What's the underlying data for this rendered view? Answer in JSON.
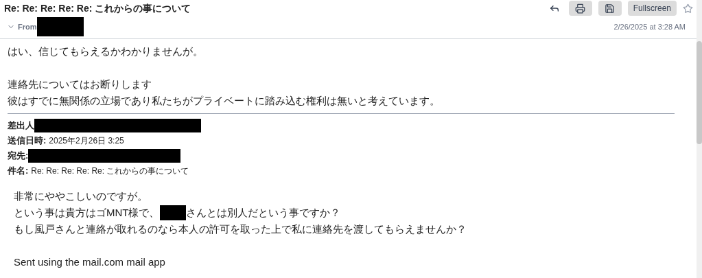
{
  "header": {
    "subject": "Re: Re: Re: Re: Re: これからの事について",
    "from_label": "From",
    "date": "2/26/2025 at 3:28 AM",
    "toolbar": [
      {
        "kind": "reply"
      },
      {
        "kind": "print"
      },
      {
        "kind": "save"
      },
      {
        "kind": "text",
        "label": "Fullscreen"
      },
      {
        "kind": "star"
      }
    ]
  },
  "body": [
    {
      "kind": "text",
      "parts": [
        {
          "kind": "text",
          "text": "はい、信じてもらえるかわかりませんが。"
        }
      ]
    },
    {
      "kind": "blank"
    },
    {
      "kind": "text",
      "parts": [
        {
          "kind": "text",
          "text": "連絡先についてはお断りします"
        }
      ]
    },
    {
      "kind": "text",
      "parts": [
        {
          "kind": "text",
          "text": "彼はすでに無関係の立場であり私たちがプライベートに踏み込む権利は無いと考えています。"
        }
      ]
    }
  ],
  "quoted_header": [
    {
      "label": "差出人",
      "kind": "redacted"
    },
    {
      "label": "送信日時:",
      "kind": "text",
      "value": "2025年2月26日 3:25"
    },
    {
      "label": "宛先:",
      "kind": "redacted"
    },
    {
      "label": "件名:",
      "kind": "text",
      "value": "Re: Re: Re: Re: Re: これからの事について"
    }
  ],
  "quoted_body": [
    {
      "kind": "text",
      "parts": [
        {
          "kind": "text",
          "text": "非常にややこしいのですが。"
        }
      ]
    },
    {
      "kind": "text",
      "parts": [
        {
          "kind": "text",
          "text": "という事は貴方はゴMNT様で、"
        },
        {
          "kind": "redacted"
        },
        {
          "kind": "text",
          "text": "さんとは別人だという事ですか？"
        }
      ]
    },
    {
      "kind": "text",
      "parts": [
        {
          "kind": "text",
          "text": "もし風戸さんと連絡が取れるのなら本人の許可を取った上で私に連絡先を渡してもらえませんか？"
        }
      ]
    },
    {
      "kind": "blank"
    },
    {
      "kind": "text",
      "parts": [
        {
          "kind": "text",
          "text": "Sent using the mail.com mail app"
        }
      ]
    }
  ]
}
